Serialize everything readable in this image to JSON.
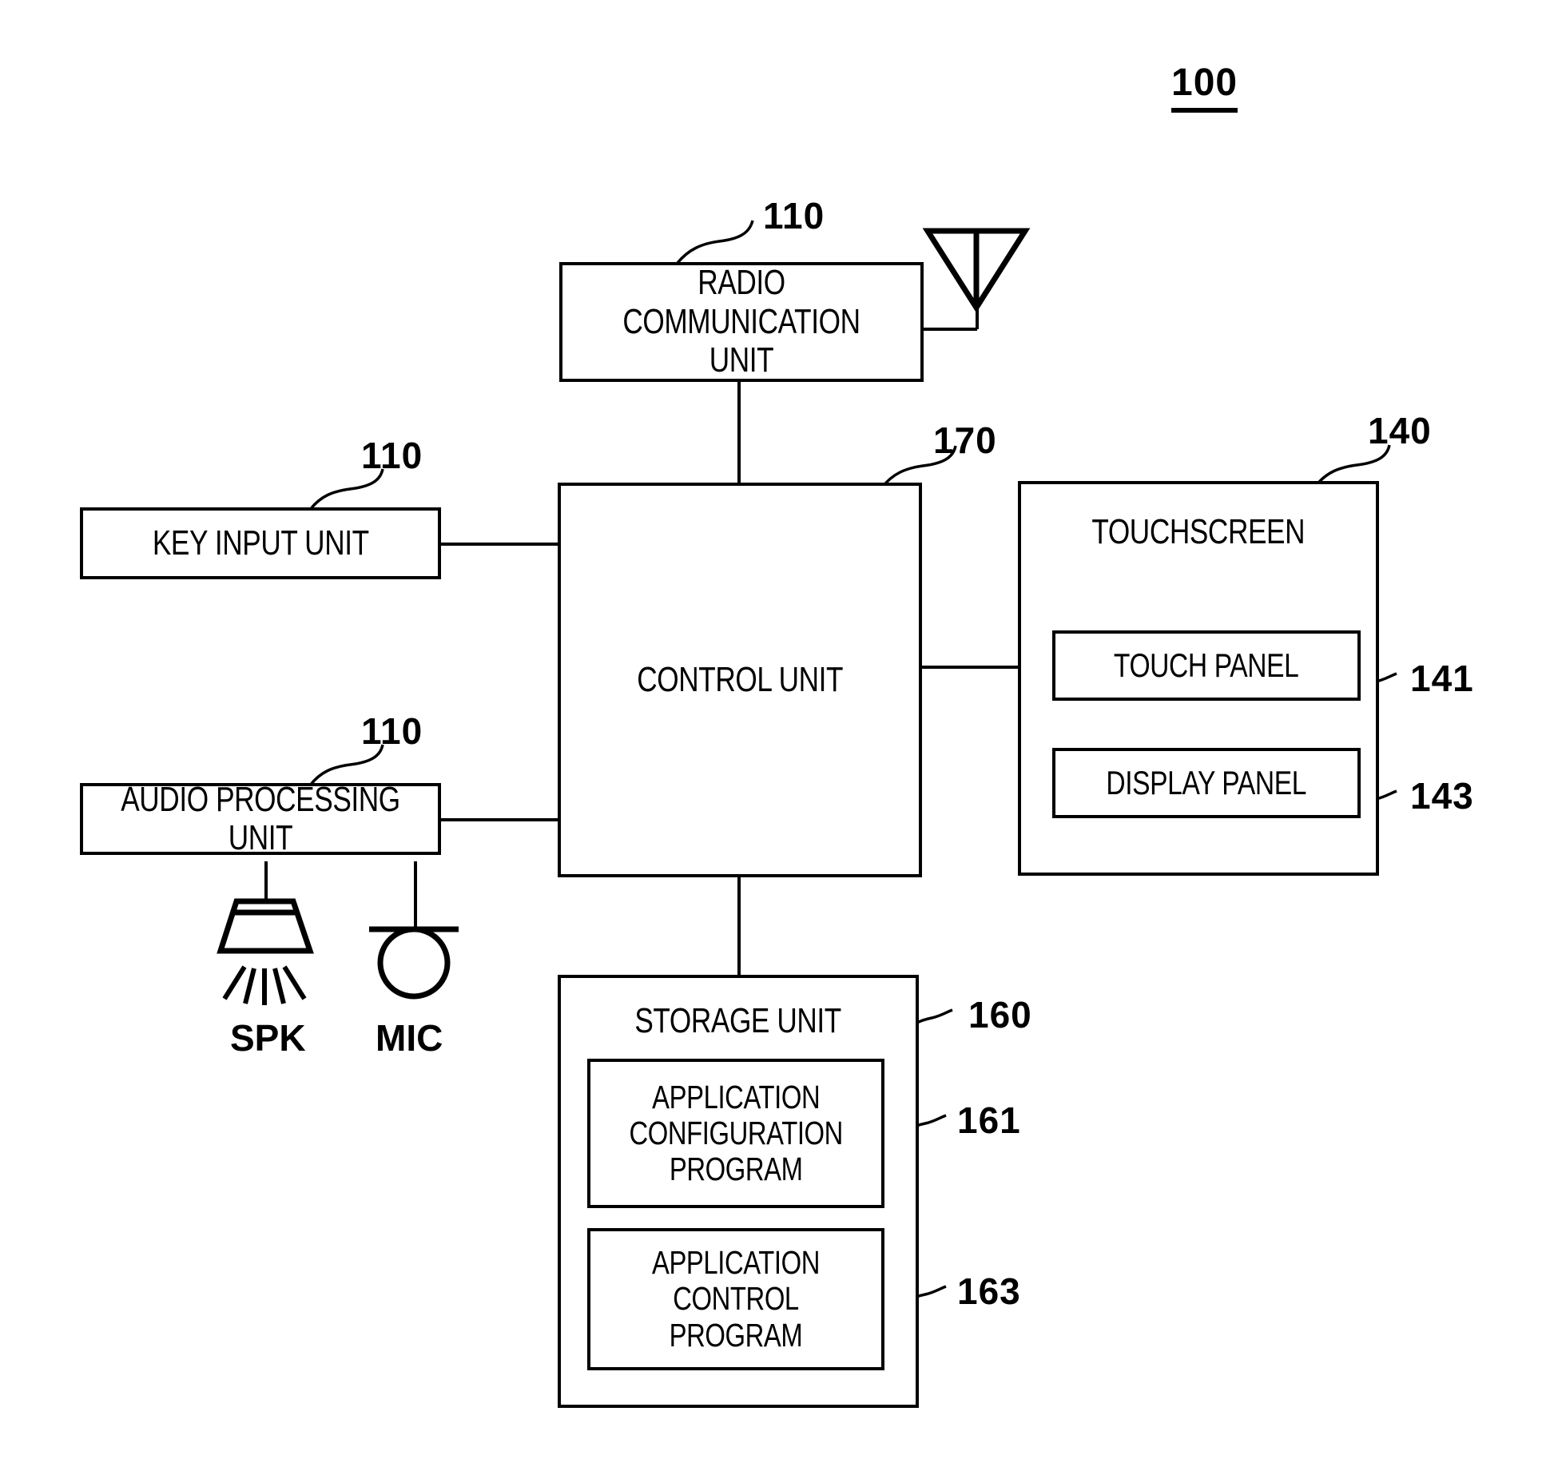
{
  "figure": {
    "device_ref": "100"
  },
  "blocks": {
    "radio": {
      "label": "RADIO COMMUNICATION\nUNIT",
      "ref": "110"
    },
    "key_input": {
      "label": "KEY INPUT UNIT",
      "ref": "110"
    },
    "audio": {
      "label": "AUDIO PROCESSING UNIT",
      "ref": "110"
    },
    "control": {
      "label": "CONTROL UNIT",
      "ref": "170"
    },
    "touchscreen": {
      "label": "TOUCHSCREEN",
      "ref": "140"
    },
    "touch_panel": {
      "label": "TOUCH PANEL",
      "ref": "141"
    },
    "display_panel": {
      "label": "DISPLAY PANEL",
      "ref": "143"
    },
    "storage": {
      "label": "STORAGE UNIT",
      "ref": "160"
    },
    "app_config": {
      "label": "APPLICATION\nCONFIGURATION\nPROGRAM",
      "ref": "161"
    },
    "app_control": {
      "label": "APPLICATION\nCONTROL PROGRAM",
      "ref": "163"
    }
  },
  "peripherals": {
    "speaker": {
      "label": "SPK",
      "icon": "speaker-icon"
    },
    "microphone": {
      "label": "MIC",
      "icon": "microphone-icon"
    },
    "antenna": {
      "icon": "antenna-icon"
    }
  }
}
